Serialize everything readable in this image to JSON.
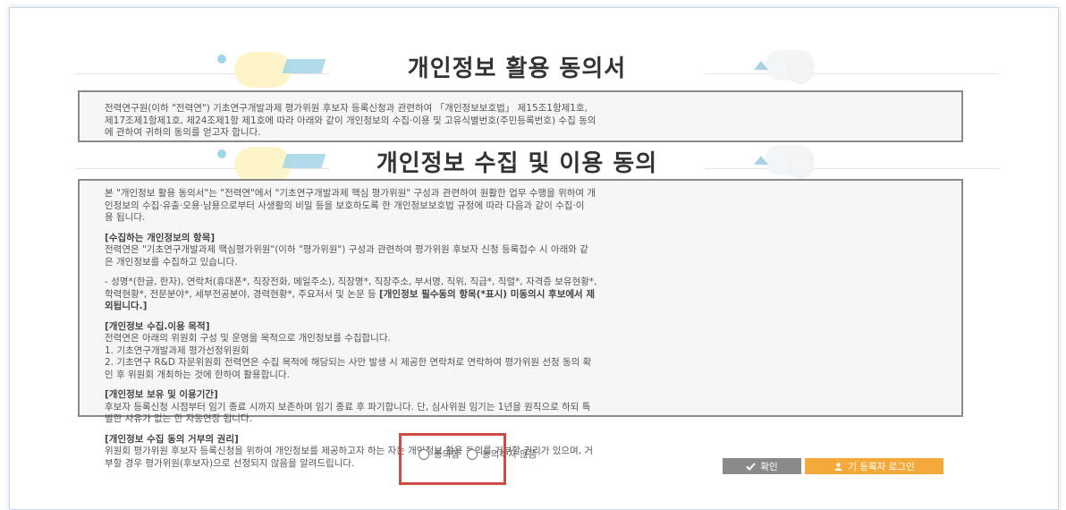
{
  "colors": {
    "accent_orange": "#f5a93a",
    "highlight_red": "#cc4b43",
    "button_gray": "#8a8a8a"
  },
  "heading1": {
    "title": "개인정보 활용 동의서"
  },
  "intro": {
    "line1": "전력연구원(이하 \"전력연\") 기초연구개발과제 평가위원 후보자 등록신청과 관련하여 「개인정보보호법」 제15조1항제1호,",
    "line2": "제17조제1항제1호, 제24조제1항 제1호에 따라 아래와 같이 개인정보의 수집·이용 및 고유식별번호(주민등록번호) 수집 동의",
    "line3": "에 관하여 귀하의 동의를 얻고자 합니다."
  },
  "heading2": {
    "title": "개인정보 수집 및 이용 동의"
  },
  "consent": {
    "intro_l1": "본 \"개인정보 활용 동의서\"는 \"전력연\"에서 \"기초연구개발과제 핵심 평가위원\" 구성과 관련하여 원활한 업무 수행을 위하여 개",
    "intro_l2": "인정보의 수집·유출·오용·남용으로부터 사생활의 비밀 등을 보호하도록 한 개인정보보호법 규정에 따라 다음과 같이 수집·이",
    "intro_l3": "용 됩니다.",
    "items_title": "[수집하는 개인정보의 항목]",
    "items_l1": "전력연은 \"기초연구개발과제 핵심평가위원\"(이하 \"평가위원\") 구성과 관련하여 평가위원 후보자 신청 등록접수 시 아래와 같",
    "items_l2": "은 개인정보를 수집하고 있습니다.",
    "items_list_l1": "- 성명*(한글, 한자), 연락처(휴대폰*, 직장전화, 메일주소), 직장명*, 직장주소, 부서명, 직위, 직급*, 직렬*, 자격증 보유현황*,",
    "items_list_l2_plain": "학력현황*, 전문분야*, 세부전공분야, 경력현황*, 주요저서 및 논문 등 ",
    "items_list_l2_bold": "[개인정보 필수동의 항목(*표시) 미동의시 후보에서 제",
    "items_list_l3_bold": "외됩니다.]",
    "purpose_title": "[개인정보 수집.이용 목적]",
    "purpose_l1": "전력연은 아래의 위원회 구성 및 운영을 목적으로 개인정보를 수집합니다.",
    "purpose_l2": "1. 기초연구개발과제 평가선정위원회",
    "purpose_l3": "2. 기초연구 R&D 자문위원회 전력연은 수집 목적에 해당되는 사안 발생 시 제공한 연락처로 연락하여 평가위원 선정 동의 확",
    "purpose_l4": "인 후 위원회 개최하는 것에 한하여 활용합니다.",
    "retention_title": "[개인정보 보유 및 이용기간]",
    "retention_l1": "후보자 등록신청 시점부터 임기 종료 시까지 보존하며 임기 종료 후 파기합니다. 단, 심사위원 임기는 1년을 원칙으로 하되 특",
    "retention_l2": "별한 사유가 없는 한 자동연장 됩니다.",
    "refusal_title": "[개인정보 수집 동의 거부의 권리]",
    "refusal_l1": "위원회 평가위원 후보자 등록신청을 위하여 개인정보를 제공하고자 하는 자는 개인정보 활용 동의를 거부할 권리가 있으며, 거",
    "refusal_l2": "부할 경우 평가위원(후보자)으로 선정되지 않음을 알려드립니다."
  },
  "choices": {
    "agree": "동의함",
    "disagree": "동의하지 않음"
  },
  "buttons": {
    "confirm": "확인",
    "login": "기 등록자 로그인"
  }
}
